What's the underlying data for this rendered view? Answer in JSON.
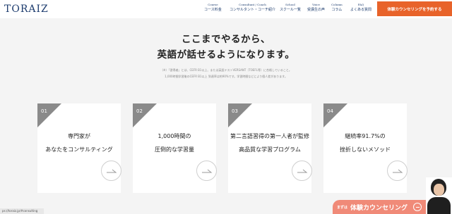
{
  "header": {
    "logo": "TORAIZ",
    "nav": [
      {
        "en": "Course",
        "jp": "コース料金"
      },
      {
        "en": "Consultant / Coach",
        "jp": "コンサルタント・コーチ紹介"
      },
      {
        "en": "School",
        "jp": "スクール一覧"
      },
      {
        "en": "Voice",
        "jp": "受講生の声"
      },
      {
        "en": "Column",
        "jp": "コラム"
      },
      {
        "en": "FAQ",
        "jp": "よくある質問"
      }
    ],
    "cta": "体験カウンセリングを予約する"
  },
  "hero": {
    "title_line1": "ここまでやるから、",
    "title_line2": "英語が話せるようになります。",
    "note_line1": "（※）「習得者」とは、CEFR B1以上、または英語テストVERSANT（TOEFL等）に合格していること。",
    "note_line2": "1,000時間学習後のCEFR B1以上 到達率は約90%です。学習時間などにより個人差があります。"
  },
  "cards": [
    {
      "num": "01",
      "line1": "専門家が",
      "line2": "あなたをコンサルティング"
    },
    {
      "num": "02",
      "line1": "1,000時間の",
      "line2": "圧倒的な学習量"
    },
    {
      "num": "03",
      "line1": "第二言語習得の第一人者が監修",
      "line2": "高品質な学習プログラム"
    },
    {
      "num": "04",
      "line1": "継続率91.7%の",
      "line2": "挫折しないメソッド"
    }
  ],
  "status_url": "ps://toraiz.jp/#consulting",
  "floating_cta": {
    "prefix": "まずは",
    "label": "体験カウンセリング"
  },
  "colors": {
    "brand": "#1d3c6e",
    "accent": "#e8632a",
    "float": "#f08a78"
  }
}
